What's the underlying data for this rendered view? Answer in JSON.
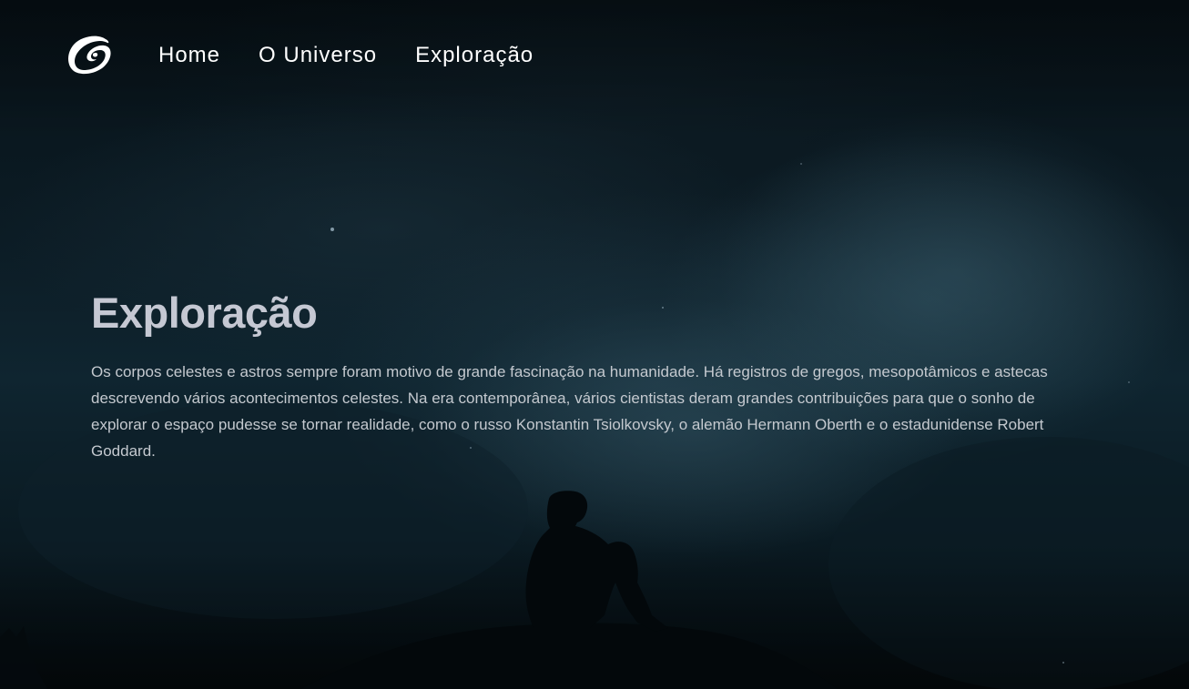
{
  "nav": {
    "logo_icon": "swirl-galaxy-logo-icon",
    "items": [
      {
        "label": "Home"
      },
      {
        "label": "O Universo"
      },
      {
        "label": "Exploração"
      }
    ]
  },
  "hero": {
    "title": "Exploração",
    "text": "Os corpos celestes e astros sempre foram motivo de grande fascinação na humanidade. Há registros de gregos, mesopotâmicos e astecas descrevendo vários acontecimentos celestes. Na era contemporânea, vários cientistas deram grandes contribuições para que o sonho de explorar o espaço pudesse se tornar realidade, como o russo Konstantin Tsiolkovsky, o alemão Hermann Oberth e o estadunidense Robert Goddard."
  },
  "colors": {
    "nav_text": "#ffffff",
    "title": "#c5c8d3",
    "body_text": "#c4c9cf",
    "sky_dark": "#071218",
    "sky_mid": "#0f2530"
  }
}
